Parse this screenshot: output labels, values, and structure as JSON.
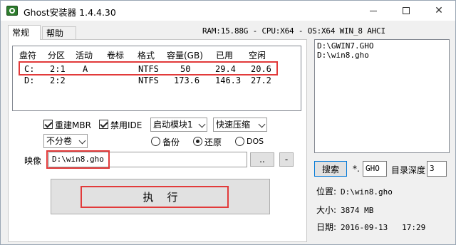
{
  "window": {
    "title": "Ghost安装器 1.4.4.30",
    "minimize_glyph": "—",
    "maximize_glyph": "□",
    "close_glyph": "✕"
  },
  "tabs": [
    {
      "label": "常规"
    },
    {
      "label": "帮助"
    }
  ],
  "sysinfo": "RAM:15.88G - CPU:X64 - OS:X64 WIN_8 AHCI",
  "partition_table": {
    "headers": [
      "盘符",
      "分区",
      "活动",
      "卷标",
      "格式",
      "容量(GB)",
      "已用",
      "空闲"
    ],
    "rows": [
      [
        "C:",
        "2:1",
        "A",
        "",
        "NTFS",
        "50",
        "29.4",
        "20.6"
      ],
      [
        "D:",
        "2:2",
        "",
        "",
        "NTFS",
        "173.6",
        "146.3",
        "27.2"
      ]
    ]
  },
  "options": {
    "rebuild_mbr": "重建MBR",
    "disable_ide": "禁用IDE",
    "boot_module": "启动模块1",
    "compression": "快速压缩",
    "split_volume": "不分卷",
    "mode_backup": "备份",
    "mode_restore": "还原",
    "mode_dos": "DOS"
  },
  "image": {
    "label": "映像",
    "path": "D:\\win8.gho",
    "browse_label": "..",
    "minus_label": "-"
  },
  "execute_label": "执    行",
  "file_list": [
    "D:\\GWIN7.GHO",
    "D:\\win8.gho"
  ],
  "search": {
    "button_label": "搜索",
    "star_label": "*.",
    "ext_value": "GHO",
    "depth_label": "目录深度",
    "depth_value": "3"
  },
  "details": {
    "location_label": "位置:",
    "location_value": "D:\\win8.gho",
    "size_label": "大小:",
    "size_value": "3874 MB",
    "date_label": "日期:",
    "date_value": "2016-09-13   17:29"
  },
  "colors": {
    "highlight_box": "#e23a3a",
    "window_bg": "#f0f0f0"
  }
}
